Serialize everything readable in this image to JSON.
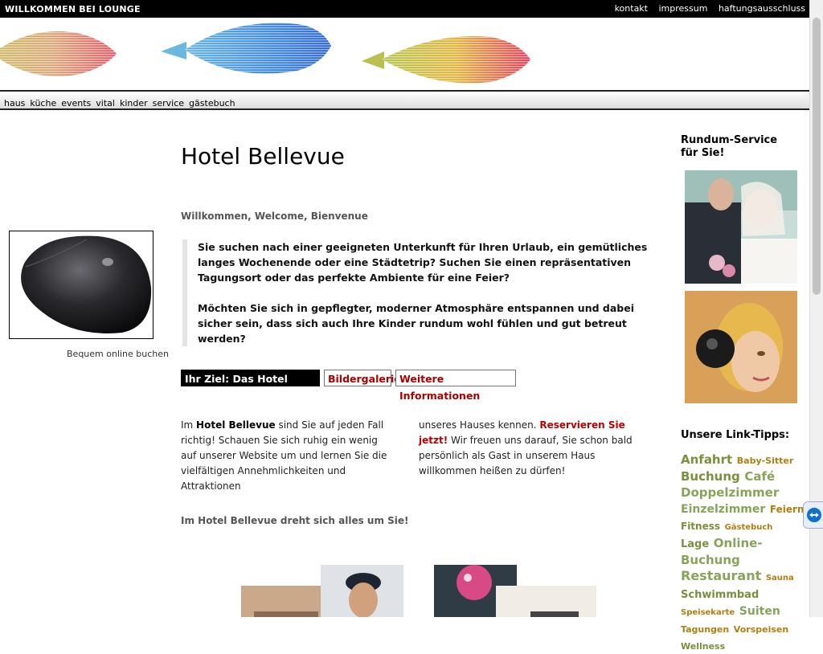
{
  "header": {
    "site_title": "WILLKOMMEN BEI LOUNGE",
    "links": [
      "kontakt",
      "impressum",
      "haftungsausschluss"
    ]
  },
  "nav": [
    "haus",
    "küche",
    "events",
    "vital",
    "kinder",
    "service",
    "gästebuch"
  ],
  "left": {
    "promo_caption": "Bequem online buchen"
  },
  "main": {
    "title": "Hotel Bellevue",
    "welcome": "Willkommen, Welcome, Bienvenue",
    "quote_p1": "Sie suchen nach einer geeigneten Unterkunft für Ihren Urlaub, ein gemütliches langes Wochenende oder eine Städtetrip? Suchen Sie einen repräsentativen Tagungsort oder das perfekte Ambiente für eine Feier?",
    "quote_p2": "Möchten Sie sich in gepflegter, moderner Atmosphäre entspannen und dabei sicher sein, dass sich auch Ihre Kinder rundum wohl fühlen und gut betreut werden?",
    "buttons": [
      "Ihr Ziel: Das Hotel Bellevue",
      "Bildergalerie",
      "Weitere Informationen"
    ],
    "col1_prefix": "Im ",
    "col1_bold": "Hotel Bellevue",
    "col1_rest": " sind Sie auf jeden Fall richtig! Schauen Sie sich ruhig ein wenig auf unserer Website um und lernen Sie die vielfältigen Annehmlichkeiten und Attraktionen",
    "col2_prefix": "unseres Hauses kennen. ",
    "col2_link": "Reservieren Sie jetzt!",
    "col2_rest": " Wir freuen uns darauf, Sie schon bald persönlich als Gast in unserem Haus willkommen heißen zu dürfen!",
    "section_heading": "Im Hotel Bellevue dreht sich alles um Sie!"
  },
  "aside": {
    "service_heading": "Rundum-Service für Sie!",
    "links_heading": "Unsere Link-Tipps:",
    "tags": [
      {
        "label": "Anfahrt",
        "size": 15,
        "color": "olive"
      },
      {
        "label": "Baby-Sitter",
        "size": 11,
        "color": "gold"
      },
      {
        "label": "Buchung",
        "size": 15,
        "color": "olive"
      },
      {
        "label": "Café",
        "size": 15,
        "color": "green"
      },
      {
        "label": "Doppelzimmer",
        "size": 15,
        "color": "green"
      },
      {
        "label": "Einzelzimmer",
        "size": 14,
        "color": "green"
      },
      {
        "label": "Feiern",
        "size": 12,
        "color": "gold"
      },
      {
        "label": "Fitness",
        "size": 12,
        "color": "olive"
      },
      {
        "label": "Gästebuch",
        "size": 10,
        "color": "gold"
      },
      {
        "label": "Lage",
        "size": 13,
        "color": "olive"
      },
      {
        "label": "Online-Buchung",
        "size": 15,
        "color": "green"
      },
      {
        "label": "Restaurant",
        "size": 16,
        "color": "green"
      },
      {
        "label": "Sauna",
        "size": 10,
        "color": "gold"
      },
      {
        "label": "Schwimmbad",
        "size": 13,
        "color": "olive"
      },
      {
        "label": "Speisekarte",
        "size": 10,
        "color": "gold"
      },
      {
        "label": "Suiten",
        "size": 14,
        "color": "green"
      },
      {
        "label": "Tagungen",
        "size": 11,
        "color": "gold"
      },
      {
        "label": "Vorspeisen",
        "size": 11,
        "color": "gold"
      },
      {
        "label": "Wellness",
        "size": 11,
        "color": "olive"
      }
    ]
  }
}
